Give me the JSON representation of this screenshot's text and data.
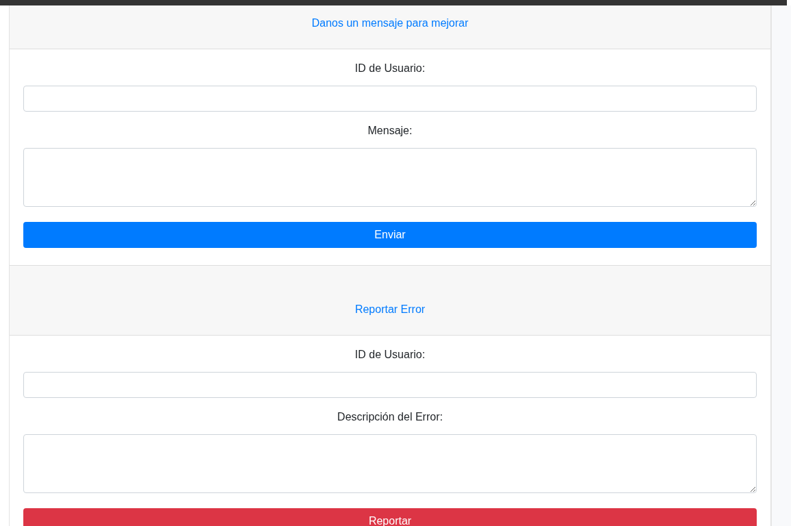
{
  "sections": [
    {
      "title": "Danos un mensaje para mejorar",
      "fields": [
        {
          "label": "ID de Usuario:",
          "kind": "input"
        },
        {
          "label": "Mensaje:",
          "kind": "textarea"
        }
      ],
      "button": {
        "label": "Enviar",
        "kind": "submit"
      }
    },
    {
      "title": "Reportar Error",
      "fields": [
        {
          "label": "ID de Usuario:",
          "kind": "input"
        },
        {
          "label": "Descripción del Error:",
          "kind": "textarea"
        }
      ],
      "button": {
        "label": "Reportar",
        "kind": "report"
      }
    }
  ]
}
